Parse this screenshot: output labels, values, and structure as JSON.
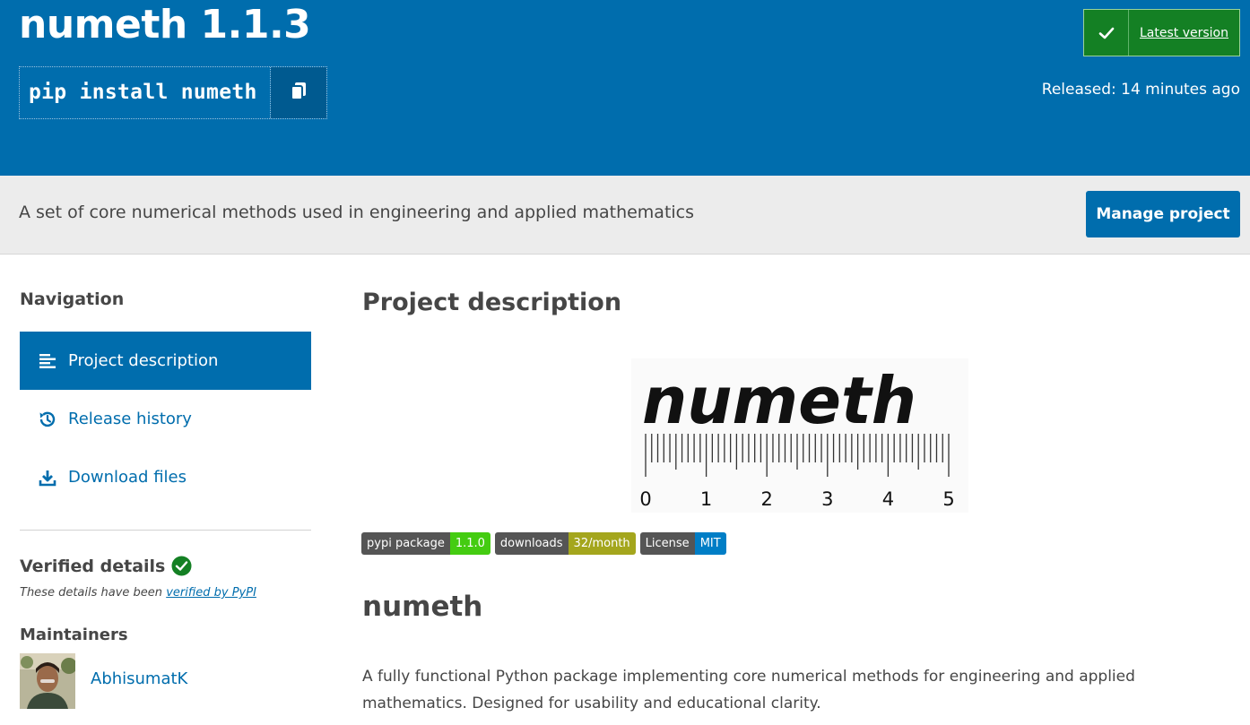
{
  "header": {
    "package_title": "numeth 1.1.3",
    "pip_command": "pip install numeth",
    "copy_icon": "copy-icon",
    "status_label": "Latest version",
    "released": "Released: 14 minutes ago",
    "bg_color": "#006dad",
    "status_color": "#148024"
  },
  "band": {
    "summary": "A set of core numerical methods used in engineering and applied mathematics",
    "manage_label": "Manage project"
  },
  "sidebar": {
    "nav_heading": "Navigation",
    "items": [
      {
        "label": "Project description",
        "icon": "align-left-icon",
        "active": true
      },
      {
        "label": "Release history",
        "icon": "history-icon",
        "active": false
      },
      {
        "label": "Download files",
        "icon": "download-icon",
        "active": false
      }
    ],
    "verified_heading": "Verified details",
    "verified_note_prefix": "These details have been ",
    "verified_note_link": "verified by PyPI",
    "maintainers_heading": "Maintainers",
    "maintainer_name": "AbhisumatK"
  },
  "main": {
    "section_heading": "Project description",
    "logo": {
      "wordmark": "numeth",
      "scale_labels": [
        "0",
        "1",
        "2",
        "3",
        "4",
        "5"
      ]
    },
    "badges": [
      {
        "left": "pypi package",
        "right": "1.1.0",
        "color": "#4c1"
      },
      {
        "left": "downloads",
        "right": "32/month",
        "color": "#a4a61d"
      },
      {
        "left": "License",
        "right": "MIT",
        "color": "#007ec6"
      }
    ],
    "readme_heading": "numeth",
    "readme_paragraph": "A fully functional Python package implementing core numerical methods for engineering and applied mathematics. Designed for usability and educational clarity."
  }
}
